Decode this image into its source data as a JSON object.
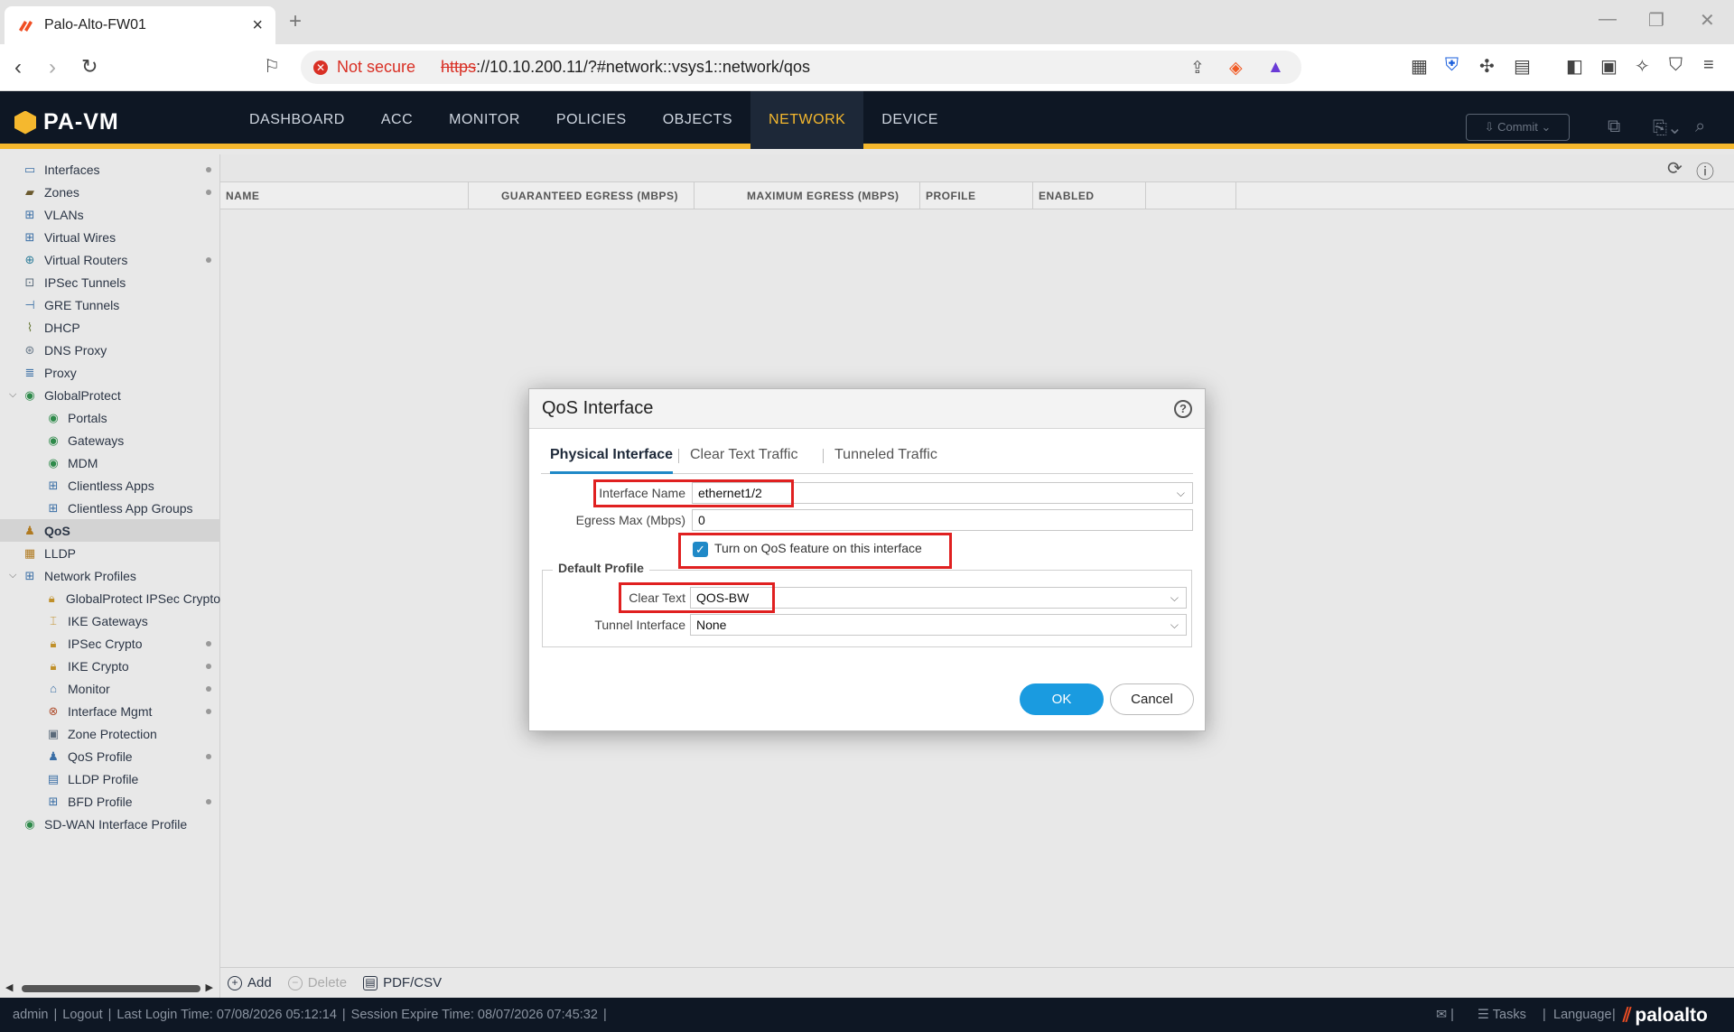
{
  "browser": {
    "tab_title": "Palo-Alto-FW01",
    "not_secure": "Not secure",
    "url_scheme": "https",
    "url_rest": "://10.10.200.11/?#network::vsys1::network/qos"
  },
  "app": {
    "logo": "PA-VM",
    "nav": [
      "DASHBOARD",
      "ACC",
      "MONITOR",
      "POLICIES",
      "OBJECTS",
      "NETWORK",
      "DEVICE"
    ],
    "active_nav": "NETWORK",
    "commit_label": "Commit"
  },
  "sidebar": {
    "items": [
      {
        "label": "Interfaces",
        "icon": "interfaces-icon"
      },
      {
        "label": "Zones",
        "icon": "zones-icon"
      },
      {
        "label": "VLANs",
        "icon": "vlans-icon"
      },
      {
        "label": "Virtual Wires",
        "icon": "virtual-wires-icon"
      },
      {
        "label": "Virtual Routers",
        "icon": "virtual-routers-icon"
      },
      {
        "label": "IPSec Tunnels",
        "icon": "ipsec-tunnels-icon"
      },
      {
        "label": "GRE Tunnels",
        "icon": "gre-tunnels-icon"
      },
      {
        "label": "DHCP",
        "icon": "dhcp-icon"
      },
      {
        "label": "DNS Proxy",
        "icon": "dns-proxy-icon"
      },
      {
        "label": "Proxy",
        "icon": "proxy-icon"
      },
      {
        "label": "GlobalProtect",
        "icon": "globalprotect-icon"
      },
      {
        "label": "Portals",
        "icon": "portals-icon"
      },
      {
        "label": "Gateways",
        "icon": "gateways-icon"
      },
      {
        "label": "MDM",
        "icon": "mdm-icon"
      },
      {
        "label": "Clientless Apps",
        "icon": "clientless-apps-icon"
      },
      {
        "label": "Clientless App Groups",
        "icon": "clientless-app-groups-icon"
      },
      {
        "label": "QoS",
        "icon": "qos-icon"
      },
      {
        "label": "LLDP",
        "icon": "lldp-icon"
      },
      {
        "label": "Network Profiles",
        "icon": "network-profiles-icon"
      },
      {
        "label": "GlobalProtect IPSec Crypto",
        "icon": "lock-icon"
      },
      {
        "label": "IKE Gateways",
        "icon": "ike-gateways-icon"
      },
      {
        "label": "IPSec Crypto",
        "icon": "lock-icon"
      },
      {
        "label": "IKE Crypto",
        "icon": "lock-icon"
      },
      {
        "label": "Monitor",
        "icon": "monitor-icon"
      },
      {
        "label": "Interface Mgmt",
        "icon": "interface-mgmt-icon"
      },
      {
        "label": "Zone Protection",
        "icon": "zone-protection-icon"
      },
      {
        "label": "QoS Profile",
        "icon": "qos-profile-icon"
      },
      {
        "label": "LLDP Profile",
        "icon": "lldp-profile-icon"
      },
      {
        "label": "BFD Profile",
        "icon": "bfd-profile-icon"
      },
      {
        "label": "SD-WAN Interface Profile",
        "icon": "sdwan-icon"
      }
    ],
    "selected": "QoS"
  },
  "grid": {
    "columns": [
      "NAME",
      "GUARANTEED EGRESS (MBPS)",
      "MAXIMUM EGRESS (MBPS)",
      "PROFILE",
      "ENABLED"
    ]
  },
  "actions": {
    "add": "Add",
    "delete": "Delete",
    "pdf_csv": "PDF/CSV"
  },
  "status": {
    "user": "admin",
    "logout": "Logout",
    "last_login": "Last Login Time: 07/08/2026 05:12:14",
    "session_expire": "Session Expire Time: 08/07/2026 07:45:32",
    "tasks": "Tasks",
    "language": "Language",
    "brand": "paloalto"
  },
  "dialog": {
    "title": "QoS Interface",
    "tabs": [
      "Physical Interface",
      "Clear Text Traffic",
      "Tunneled Traffic"
    ],
    "active_tab": "Physical Interface",
    "interface_name_label": "Interface Name",
    "interface_name_value": "ethernet1/2",
    "egress_max_label": "Egress Max (Mbps)",
    "egress_max_value": "0",
    "qos_checkbox_label": "Turn on QoS feature on this interface",
    "qos_checkbox_checked": true,
    "default_profile_legend": "Default Profile",
    "clear_text_label": "Clear Text",
    "clear_text_value": "QOS-BW",
    "tunnel_interface_label": "Tunnel Interface",
    "tunnel_interface_value": "None",
    "ok": "OK",
    "cancel": "Cancel"
  },
  "colors": {
    "header_bg": "#0e1724",
    "accent_yellow": "#f5b82e",
    "primary_blue": "#1a9be0",
    "highlight_red": "#e02020"
  }
}
